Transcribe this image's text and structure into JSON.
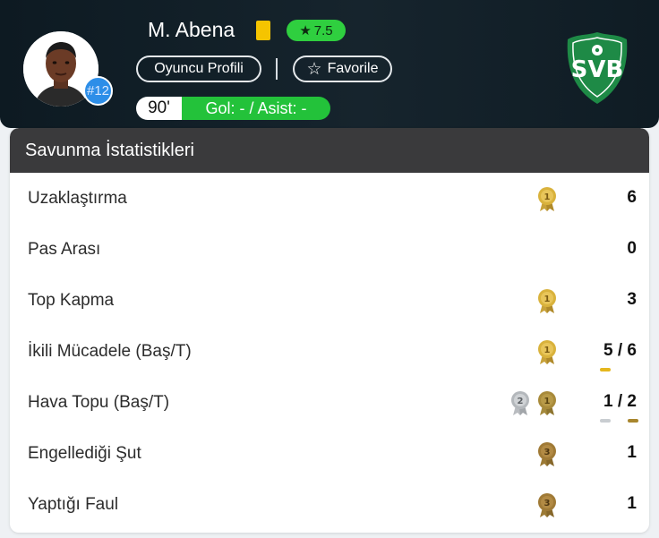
{
  "player": {
    "name": "M. Abena",
    "shirt_number": "#12",
    "rating": "7.5",
    "rating_color": "#2fcf3f",
    "card": "yellow-card",
    "profile_label": "Oyuncu Profili",
    "favorite_label": "Favorile",
    "minutes": "90'",
    "goals_assists": "Gol: - / Asist: -"
  },
  "club": {
    "logo": "SVB",
    "color": "#1e8a46"
  },
  "section": {
    "title": "Savunma İstatistikleri",
    "rows": [
      {
        "label": "Uzaklaştırma",
        "value": "6",
        "medals": [
          "gold"
        ]
      },
      {
        "label": "Pas Arası",
        "value": "0",
        "medals": []
      },
      {
        "label": "Top Kapma",
        "value": "3",
        "medals": [
          "gold"
        ]
      },
      {
        "label": "İkili Mücadele (Baş/T)",
        "value": "5 / 6",
        "medals": [
          "gold"
        ]
      },
      {
        "label": "Hava Topu (Baş/T)",
        "value": "1 / 2",
        "medals": [
          "silver",
          "gold"
        ]
      },
      {
        "label": "Engellediği Şut",
        "value": "1",
        "medals": [
          "bronze"
        ]
      },
      {
        "label": "Yaptığı Faul",
        "value": "1",
        "medals": [
          "bronze"
        ]
      }
    ]
  }
}
